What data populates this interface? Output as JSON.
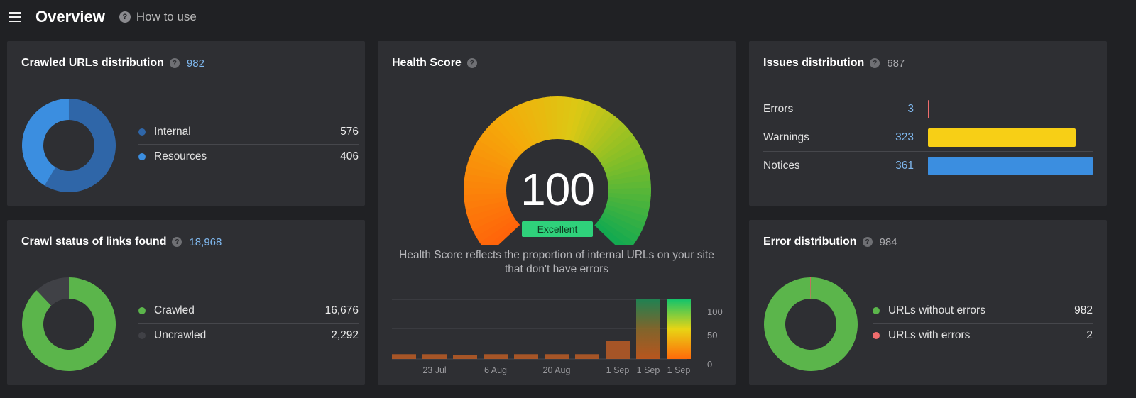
{
  "header": {
    "title": "Overview",
    "help_label": "How to use"
  },
  "crawled_urls": {
    "title": "Crawled URLs distribution",
    "count": "982",
    "legend": [
      {
        "label": "Internal",
        "value": "576",
        "color": "#2f66a8"
      },
      {
        "label": "Resources",
        "value": "406",
        "color": "#3b8ee0"
      }
    ]
  },
  "crawl_status": {
    "title": "Crawl status of links found",
    "count": "18,968",
    "legend": [
      {
        "label": "Crawled",
        "value": "16,676",
        "color": "#5bb54b"
      },
      {
        "label": "Uncrawled",
        "value": "2,292",
        "color": "#404146"
      }
    ]
  },
  "health": {
    "title": "Health Score",
    "score": "100",
    "badge": "Excellent",
    "description": "Health Score reflects the proportion of internal URLs on your site that don't have errors"
  },
  "issues": {
    "title": "Issues distribution",
    "count": "687",
    "rows": [
      {
        "label": "Errors",
        "value": "3",
        "color": "#f06d6d"
      },
      {
        "label": "Warnings",
        "value": "323",
        "color": "#f7cf16"
      },
      {
        "label": "Notices",
        "value": "361",
        "color": "#3b8ee0"
      }
    ]
  },
  "errors": {
    "title": "Error distribution",
    "count": "984",
    "legend": [
      {
        "label": "URLs without errors",
        "value": "982",
        "color": "#5bb54b"
      },
      {
        "label": "URLs with errors",
        "value": "2",
        "color": "#f06d6d"
      }
    ]
  },
  "chart_data": [
    {
      "type": "pie",
      "title": "Crawled URLs distribution",
      "categories": [
        "Internal",
        "Resources"
      ],
      "values": [
        576,
        406
      ]
    },
    {
      "type": "pie",
      "title": "Crawl status of links found",
      "categories": [
        "Crawled",
        "Uncrawled"
      ],
      "values": [
        16676,
        2292
      ]
    },
    {
      "type": "bar",
      "title": "Issues distribution",
      "categories": [
        "Errors",
        "Warnings",
        "Notices"
      ],
      "values": [
        3,
        323,
        361
      ]
    },
    {
      "type": "pie",
      "title": "Error distribution",
      "categories": [
        "URLs without errors",
        "URLs with errors"
      ],
      "values": [
        982,
        2
      ]
    },
    {
      "type": "bar",
      "title": "",
      "categories": [
        "",
        "23 Jul",
        "",
        "6 Aug",
        "",
        "20 Aug",
        "",
        "1 Sep",
        "1 Sep",
        "1 Sep"
      ],
      "values": [
        8,
        8,
        7,
        8,
        8,
        8,
        8,
        30,
        100,
        100
      ],
      "ylim": [
        0,
        100
      ],
      "yticks": [
        "0",
        "50",
        "100"
      ],
      "grid": true
    }
  ]
}
